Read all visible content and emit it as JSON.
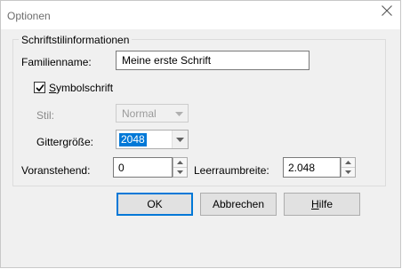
{
  "window": {
    "title": "Optionen",
    "close_icon": "close-icon"
  },
  "group": {
    "legend": "Schriftstilinformationen"
  },
  "family": {
    "label": "Familienname:",
    "value": "Meine erste Schrift"
  },
  "symbol": {
    "label": "Symbolschrift",
    "checked": true
  },
  "style": {
    "label": "Stil:",
    "value": "Normal"
  },
  "grid": {
    "label": "Gittergröße:",
    "value": "2048"
  },
  "ascent": {
    "label": "Voranstehend:",
    "value": "0"
  },
  "spacing": {
    "label": "Leerraumbreite:",
    "value": "2.048"
  },
  "buttons": {
    "ok": "OK",
    "cancel": "Abbrechen",
    "help_first": "H",
    "help_rest": "ilfe"
  },
  "colors": {
    "selection": "#0078d7",
    "dialog_bg": "#f0f0f0"
  }
}
